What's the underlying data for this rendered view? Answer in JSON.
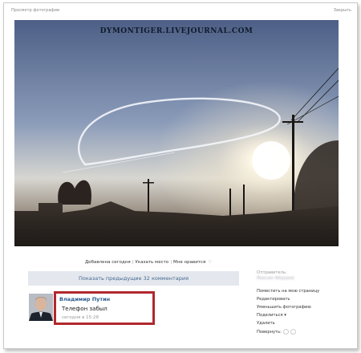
{
  "header": {
    "left": "Просмотр фотографии",
    "right": "Закрыть"
  },
  "photo": {
    "watermark": "DYMONTIGER.LIVEJOURNAL.COM"
  },
  "actions": {
    "added": "Добавлена сегодня",
    "mark_place": "Указать место",
    "like": "Мне нравится",
    "like_icon": "heart-icon"
  },
  "comments": {
    "show_previous": "Показать предыдущие 32 комментария",
    "items": [
      {
        "author": "Владимир Путин",
        "text": "Телефон забыл",
        "time": "сегодня в 15:28"
      }
    ]
  },
  "sidebar": {
    "sender_label": "Отправитель:",
    "sender_name": "Максим Фёдоров",
    "items": [
      "Поместить на мою страницу",
      "Редактировать",
      "Уменьшить фотографию",
      "Поделиться",
      "Удалить"
    ],
    "rate_label": "Повернуть:"
  },
  "colors": {
    "accent": "#2b5a8e",
    "highlight": "#b0282d",
    "button_bg": "#e4e8ee"
  }
}
